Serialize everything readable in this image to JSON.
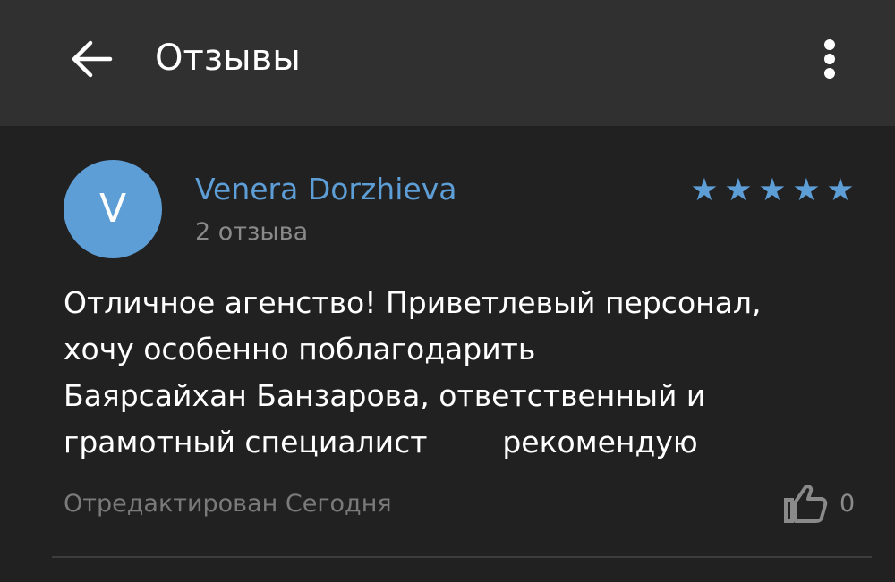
{
  "appbar": {
    "title": "Отзывы",
    "back_icon": "arrow-left-icon",
    "menu_icon": "more-vertical-icon"
  },
  "review": {
    "avatar_letter": "V",
    "author": "Venera Dorzhieva",
    "review_count": "2 отзыва",
    "rating": 5,
    "rating_max": 5,
    "text": "Отличное агенство! Приветлевый персонал,\nхочу особенно поблагодарить\nБаярсайхан Банзарова, ответственный и\nграмотный специалист        рекомендую",
    "edited": "Отредактирован Сегодня",
    "like_icon": "thumbs-up-icon",
    "likes": "0"
  },
  "colors": {
    "background": "#212121",
    "appbar": "#303030",
    "accent": "#5e9ed6",
    "text": "#ffffff",
    "muted": "#8a8a8a"
  }
}
